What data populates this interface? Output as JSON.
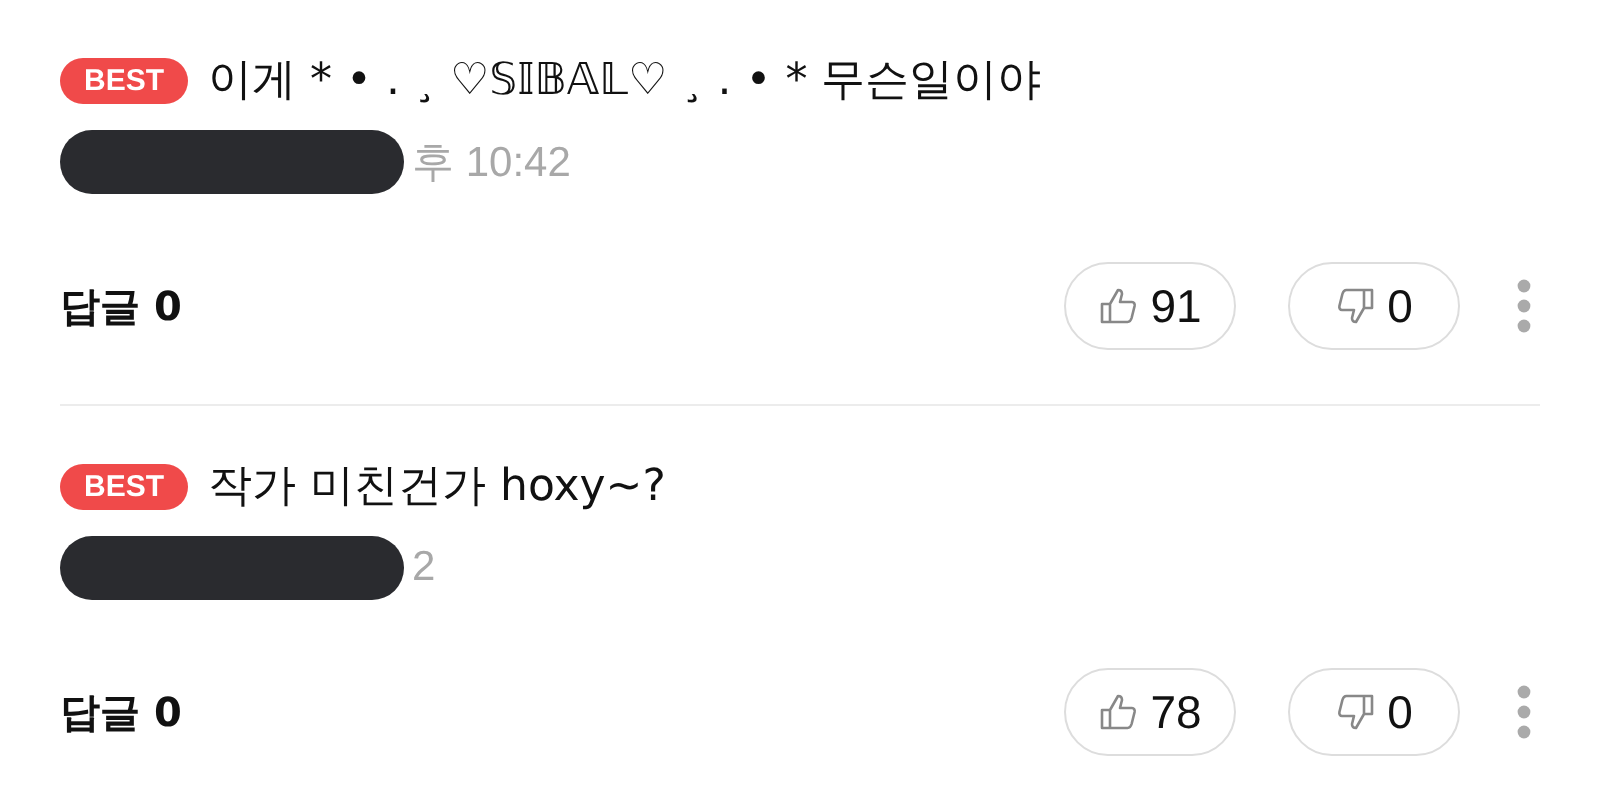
{
  "comments": [
    {
      "badge": "BEST",
      "text": "이게 * • . ¸ ♡𝕊𝕀𝔹𝔸𝕃♡ ¸ . • * 무슨일이야",
      "time": "후 10:42",
      "replies": "답글 0",
      "likes": "91",
      "dislikes": "0"
    },
    {
      "badge": "BEST",
      "text": "작가 미친건가 hoxy~?",
      "time": "2",
      "replies": "답글 0",
      "likes": "78",
      "dislikes": "0"
    }
  ]
}
